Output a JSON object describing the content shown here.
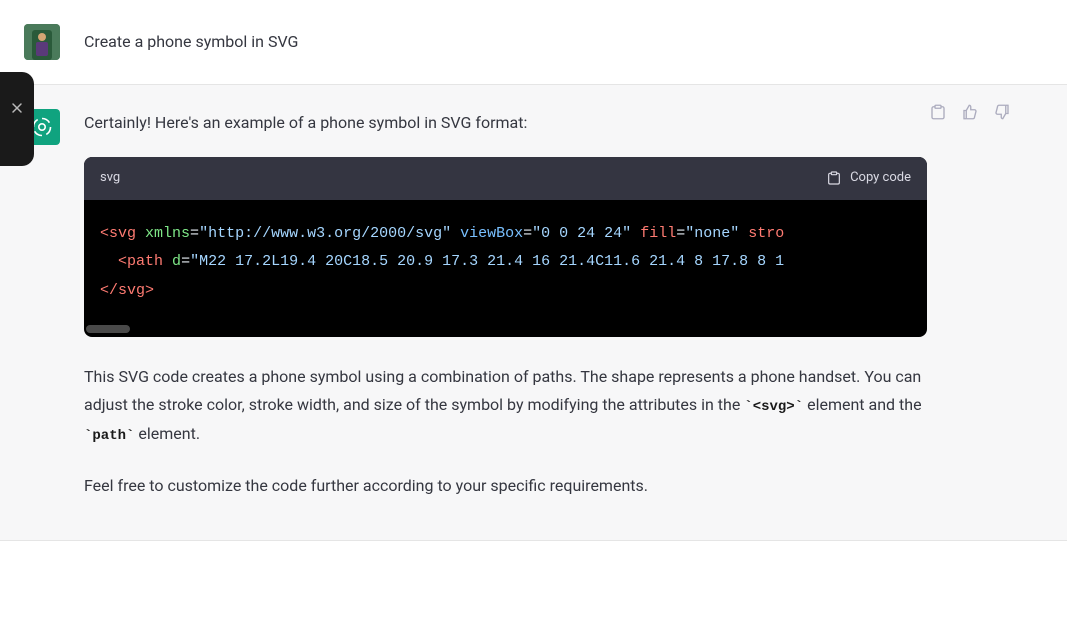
{
  "close_tab": {
    "label": "Close"
  },
  "user": {
    "prompt": "Create a phone symbol in SVG"
  },
  "assistant": {
    "intro": "Certainly! Here's an example of a phone symbol in SVG format:",
    "code": {
      "language": "svg",
      "copy_label": "Copy code",
      "tokens": {
        "open_svg": "<svg",
        "xmlns_attr": "xmlns",
        "xmlns_val": "\"http://www.w3.org/2000/svg\"",
        "viewbox_attr": "viewBox",
        "viewbox_val": "\"0 0 24 24\"",
        "fill_attr": "fill",
        "fill_val": "\"none\"",
        "stroke_attr": "stro",
        "open_path": "<path",
        "d_attr": "d",
        "d_val": "\"M22 17.2L19.4 20C18.5 20.9 17.3 21.4 16 21.4C11.6 21.4 8 17.8 8 1",
        "close_svg": "</svg>"
      }
    },
    "explain_before": "This SVG code creates a phone symbol using a combination of paths. The shape represents a phone handset. You can adjust the stroke color, stroke width, and size of the symbol by modifying the attributes in the ",
    "code_svg": "`<svg>`",
    "explain_middle": " element and the ",
    "code_path": "`path`",
    "explain_after": " element.",
    "closing": "Feel free to customize the code further according to your specific requirements."
  },
  "feedback": {
    "copy": "Copy",
    "like": "Like",
    "dislike": "Dislike"
  }
}
